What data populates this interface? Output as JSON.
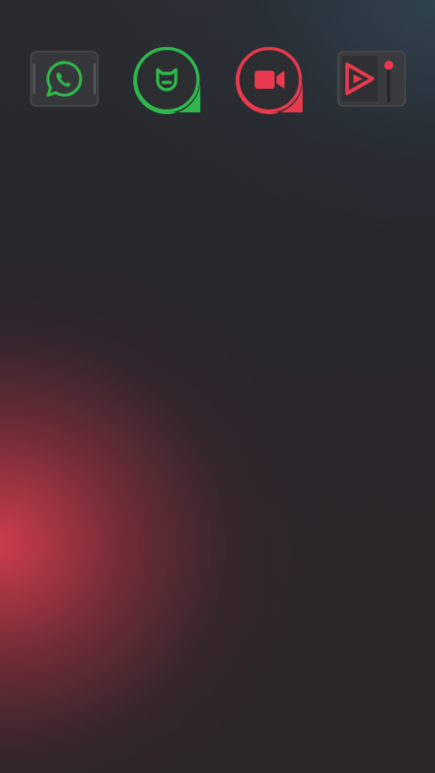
{
  "home_screen": {
    "apps": [
      {
        "icon": "whatsapp-icon",
        "accent": "#2eb84b"
      },
      {
        "icon": "mi-home-icon",
        "accent": "#2eb84b"
      },
      {
        "icon": "video-camera-icon",
        "accent": "#e8394e"
      },
      {
        "icon": "video-player-icon",
        "accent": "#e8394e"
      }
    ]
  }
}
